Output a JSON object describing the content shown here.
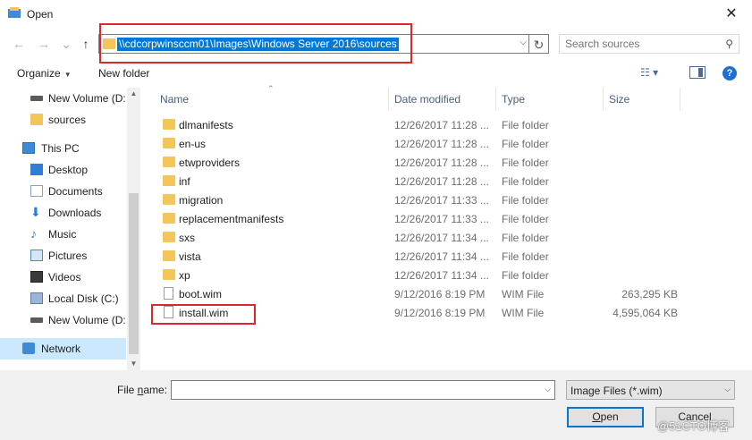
{
  "window": {
    "title": "Open",
    "close_symbol": "✕"
  },
  "nav": {
    "back": "←",
    "forward": "→",
    "recent": "⌄",
    "up": "↑",
    "address": "\\\\cdcorpwinsccm01\\Images\\Windows Server 2016\\sources",
    "refresh": "↻",
    "search_placeholder": "Search sources"
  },
  "toolbar": {
    "organize": "Organize",
    "new_folder": "New folder",
    "help": "?"
  },
  "sidebar": {
    "items": [
      {
        "label": "New Volume (D:",
        "icon": "drive-icon"
      },
      {
        "label": "sources",
        "icon": "folder-icon"
      },
      {
        "label": "This PC",
        "icon": "pc-icon"
      },
      {
        "label": "Desktop",
        "icon": "desktop-icon"
      },
      {
        "label": "Documents",
        "icon": "documents-icon"
      },
      {
        "label": "Downloads",
        "icon": "downloads-icon"
      },
      {
        "label": "Music",
        "icon": "music-icon"
      },
      {
        "label": "Pictures",
        "icon": "pictures-icon"
      },
      {
        "label": "Videos",
        "icon": "videos-icon"
      },
      {
        "label": "Local Disk (C:)",
        "icon": "local-disk-icon"
      },
      {
        "label": "New Volume (D:",
        "icon": "drive-icon"
      },
      {
        "label": "Network",
        "icon": "network-icon"
      }
    ]
  },
  "columns": {
    "name": "Name",
    "date": "Date modified",
    "type": "Type",
    "size": "Size"
  },
  "files": [
    {
      "name": "dlmanifests",
      "date": "12/26/2017 11:28 ...",
      "type": "File folder",
      "size": "",
      "kind": "folder"
    },
    {
      "name": "en-us",
      "date": "12/26/2017 11:28 ...",
      "type": "File folder",
      "size": "",
      "kind": "folder"
    },
    {
      "name": "etwproviders",
      "date": "12/26/2017 11:28 ...",
      "type": "File folder",
      "size": "",
      "kind": "folder"
    },
    {
      "name": "inf",
      "date": "12/26/2017 11:28 ...",
      "type": "File folder",
      "size": "",
      "kind": "folder"
    },
    {
      "name": "migration",
      "date": "12/26/2017 11:33 ...",
      "type": "File folder",
      "size": "",
      "kind": "folder"
    },
    {
      "name": "replacementmanifests",
      "date": "12/26/2017 11:33 ...",
      "type": "File folder",
      "size": "",
      "kind": "folder"
    },
    {
      "name": "sxs",
      "date": "12/26/2017 11:34 ...",
      "type": "File folder",
      "size": "",
      "kind": "folder"
    },
    {
      "name": "vista",
      "date": "12/26/2017 11:34 ...",
      "type": "File folder",
      "size": "",
      "kind": "folder"
    },
    {
      "name": "xp",
      "date": "12/26/2017 11:34 ...",
      "type": "File folder",
      "size": "",
      "kind": "folder"
    },
    {
      "name": "boot.wim",
      "date": "9/12/2016 8:19 PM",
      "type": "WIM File",
      "size": "263,295 KB",
      "kind": "file"
    },
    {
      "name": "install.wim",
      "date": "9/12/2016 8:19 PM",
      "type": "WIM File",
      "size": "4,595,064 KB",
      "kind": "file"
    }
  ],
  "footer": {
    "file_name_label_prefix": "File ",
    "file_name_label_underlined": "n",
    "file_name_label_suffix": "ame:",
    "file_name_value": "",
    "file_type": "Image Files (*.wim)",
    "open_underlined": "O",
    "open_rest": "pen",
    "cancel": "Cancel"
  },
  "watermark": "@51CTO博客",
  "colors": {
    "highlight": "#e0262b",
    "accent": "#0078d7",
    "selected_row": "#cce8ff"
  }
}
